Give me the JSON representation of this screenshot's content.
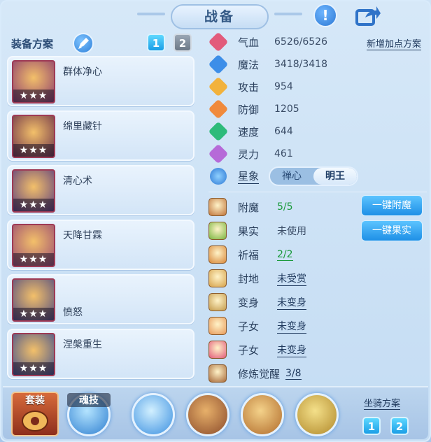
{
  "title": "战备",
  "header": {
    "info_icon": "exclamation-icon",
    "share_icon": "share-icon"
  },
  "equip_plan": {
    "title": "装备方案",
    "plan_buttons": [
      "1",
      "2"
    ],
    "active_plan": "1",
    "items": [
      {
        "name": "群体净心",
        "stars": "★★★",
        "color": "#8a3a6e"
      },
      {
        "name": "绵里藏针",
        "stars": "★★★",
        "color": "#6a2f48"
      },
      {
        "name": "清心术",
        "stars": "★★★",
        "color": "#5b3d7e"
      },
      {
        "name": "天降甘霖",
        "stars": "★★★",
        "color": "#9a4a72"
      },
      {
        "name": "愤怒",
        "stars": "★★★",
        "color": "#4f4a80"
      },
      {
        "name": "涅槃重生",
        "stars": "★★★",
        "color": "#3f4f8e"
      }
    ]
  },
  "stats": {
    "add_points_link": "新增加点方案",
    "rows": [
      {
        "label": "气血",
        "value": "6526/6526",
        "color": "#e25b7b"
      },
      {
        "label": "魔法",
        "value": "3418/3418",
        "color": "#3d8ee8"
      },
      {
        "label": "攻击",
        "value": "954",
        "color": "#f2b23c"
      },
      {
        "label": "防御",
        "value": "1205",
        "color": "#f08a3c"
      },
      {
        "label": "速度",
        "value": "644",
        "color": "#2dbb7a"
      },
      {
        "label": "灵力",
        "value": "461",
        "color": "#b66ad8"
      }
    ],
    "constellation": {
      "label": "星象",
      "options": [
        "禅心",
        "明王"
      ],
      "selected": "明王"
    }
  },
  "properties": {
    "rows": [
      {
        "label": "附魔",
        "value": "5/5",
        "style": "green-plain",
        "color": "#c0743a"
      },
      {
        "label": "果实",
        "value": "未使用",
        "style": "plain",
        "color": "#7ab640"
      },
      {
        "label": "祈福",
        "value": "2/2",
        "style": "green",
        "color": "#d8883a"
      },
      {
        "label": "封地",
        "value": "未受赏",
        "style": "link",
        "color": "#d6a24a"
      },
      {
        "label": "变身",
        "value": "未变身",
        "style": "link",
        "color": "#c49a4a"
      },
      {
        "label": "子女",
        "value": "未变身",
        "style": "link",
        "color": "#e89a5a"
      },
      {
        "label": "子女",
        "value": "未变身",
        "style": "link",
        "color": "#e25b7b"
      },
      {
        "label": "修炼觉醒",
        "value": "3/8",
        "style": "link",
        "color": "#a86a3a"
      }
    ],
    "buttons": {
      "enchant_all": "一键附魔",
      "fruit_all": "一键果实"
    }
  },
  "bottom": {
    "suit_label": "套装",
    "soul_skill_label": "魂技",
    "mount_plan": {
      "title": "坐骑方案",
      "buttons": [
        "1",
        "2"
      ],
      "active": "1"
    }
  }
}
